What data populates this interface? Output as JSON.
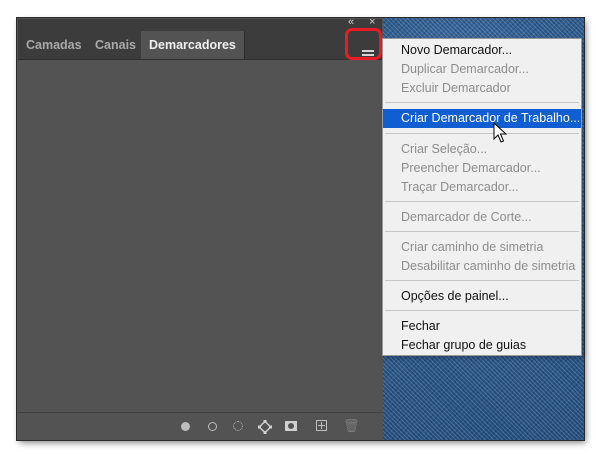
{
  "tabs": [
    {
      "label": "Camadas",
      "active": false
    },
    {
      "label": "Canais",
      "active": false
    },
    {
      "label": "Demarcadores",
      "active": true
    }
  ],
  "window_controls": {
    "collapse_glyph": "«",
    "close_glyph": "×"
  },
  "panel_menu_icon": "hamburger-icon",
  "bottom_toolbar_icons": [
    "fill-path-icon",
    "stroke-path-icon",
    "load-selection-icon",
    "make-work-path-icon",
    "add-mask-icon",
    "new-path-icon",
    "trash-icon"
  ],
  "menu": {
    "items": [
      {
        "label": "Novo Demarcador...",
        "enabled": true
      },
      {
        "label": "Duplicar Demarcador...",
        "enabled": false
      },
      {
        "label": "Excluir Demarcador",
        "enabled": false
      },
      {
        "label": "Criar Demarcador de Trabalho...",
        "enabled": true,
        "highlighted": true
      },
      {
        "label": "Criar Seleção...",
        "enabled": false
      },
      {
        "label": "Preencher Demarcador...",
        "enabled": false
      },
      {
        "label": "Traçar Demarcador...",
        "enabled": false
      },
      {
        "label": "Demarcador de Corte...",
        "enabled": false
      },
      {
        "label": "Criar caminho de simetria",
        "enabled": false
      },
      {
        "label": "Desabilitar caminho de simetria",
        "enabled": false
      },
      {
        "label": "Opções de painel...",
        "enabled": true
      },
      {
        "label": "Fechar",
        "enabled": true
      },
      {
        "label": "Fechar grupo de guias",
        "enabled": true
      }
    ]
  },
  "colors": {
    "panel_bg": "#535353",
    "tab_bar_bg": "#3c3c3c",
    "menu_bg": "#f0f0f0",
    "menu_highlight": "#0f5fd3",
    "annotation_red": "#e81c24"
  }
}
